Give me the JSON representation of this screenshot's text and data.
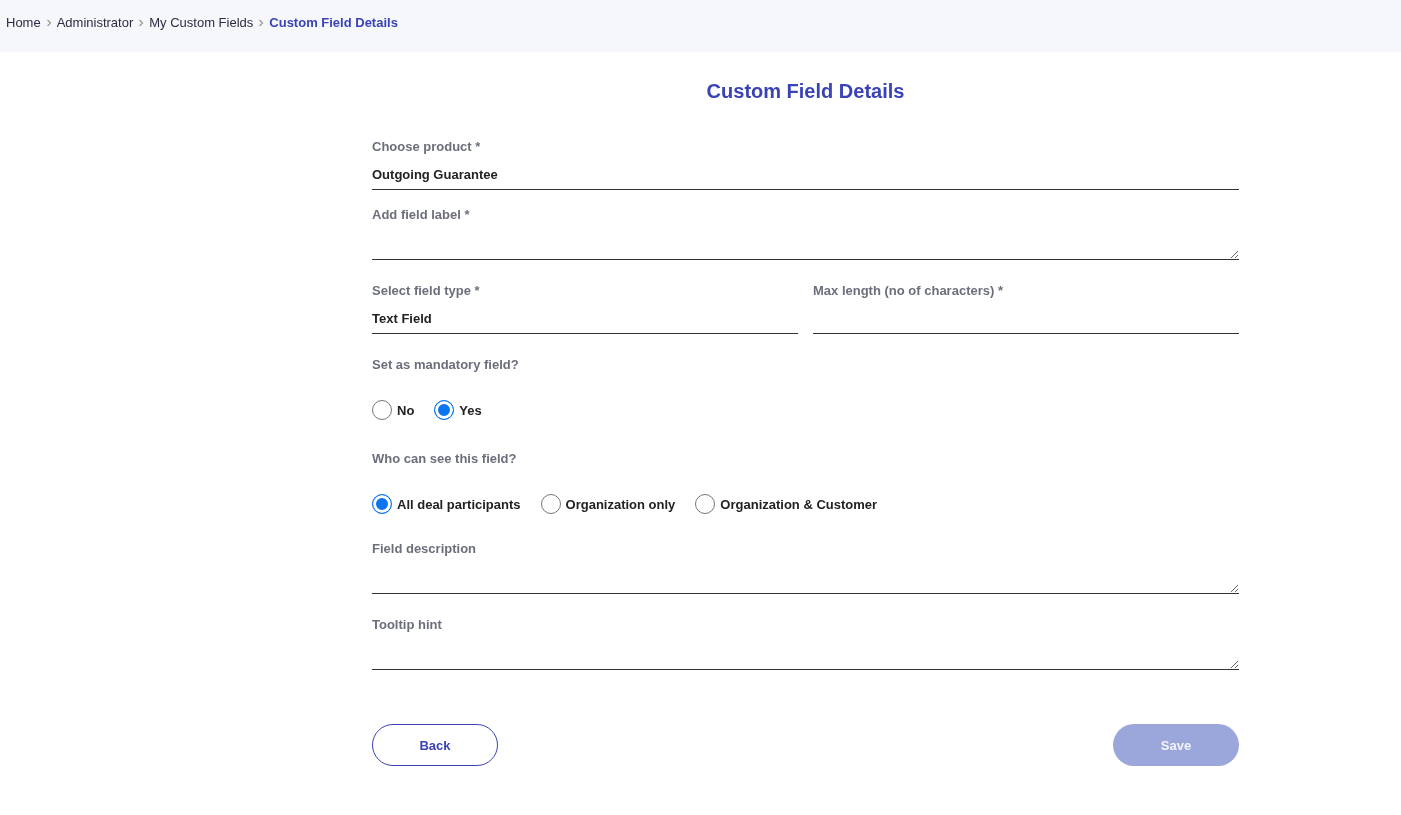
{
  "breadcrumb": [
    {
      "label": "Home",
      "current": false
    },
    {
      "label": "Administrator",
      "current": false
    },
    {
      "label": "My Custom Fields",
      "current": false
    },
    {
      "label": "Custom Field Details",
      "current": true
    }
  ],
  "title": "Custom Field Details",
  "product": {
    "kind": "line",
    "label": "Choose product *",
    "value": "Outgoing Guarantee"
  },
  "field_label": {
    "kind": "textarea",
    "label": "Add field label *"
  },
  "type_row": [
    {
      "kind": "line",
      "label": "Select field type *",
      "value": "Text Field"
    },
    {
      "kind": "line",
      "label": "Max length (no of characters) *"
    }
  ],
  "mandatory": {
    "label": "Set as mandatory field?",
    "options": [
      {
        "label": "No",
        "selected": false
      },
      {
        "label": "Yes",
        "selected": true
      }
    ]
  },
  "visibility": {
    "label": "Who can see this field?",
    "options": [
      {
        "label": "All deal participants",
        "selected": true
      },
      {
        "label": "Organization only",
        "selected": false
      },
      {
        "label": "Organization & Customer",
        "selected": false
      }
    ]
  },
  "description": {
    "kind": "textarea",
    "label": "Field description"
  },
  "tooltip": {
    "kind": "textarea",
    "label": "Tooltip hint"
  },
  "buttons": [
    {
      "label": "Back",
      "kind": "outline",
      "disabled": false
    },
    {
      "label": "Save",
      "kind": "filled",
      "disabled": true
    }
  ]
}
